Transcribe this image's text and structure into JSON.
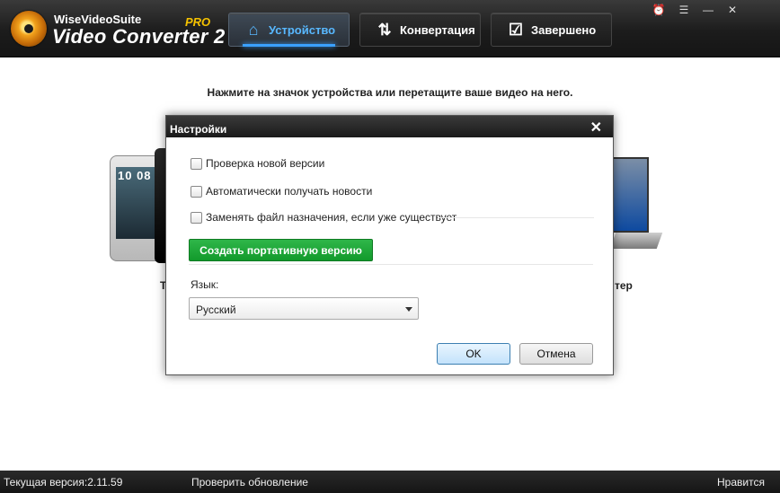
{
  "app": {
    "brand_small": "WiseVideoSuite",
    "brand_edition": "PRO",
    "brand_big": "Video Converter 2"
  },
  "tabs": [
    {
      "label": "Устройство",
      "icon": "home-icon",
      "active": true
    },
    {
      "label": "Конвертация",
      "icon": "convert-arrows-icon",
      "active": false
    },
    {
      "label": "Завершено",
      "icon": "checkbox-check-icon",
      "active": false
    }
  ],
  "window_controls": [
    "alarm-icon",
    "menu-icon",
    "minimize-icon",
    "close-icon"
  ],
  "main": {
    "instruction": "Нажмите на значок устройства или перетащите ваше видео на него.",
    "phone_clock": "10 08",
    "label_left_partial": "Т",
    "label_right_partial": "тер"
  },
  "dialog": {
    "title": "Настройки",
    "options": [
      {
        "label": "Проверка новой версии",
        "checked": false
      },
      {
        "label": "Автоматически получать новости",
        "checked": false
      },
      {
        "label": "Заменять файл назначения, если уже существует",
        "checked": false
      }
    ],
    "portable_button": "Создать портативную версию",
    "language_label": "Язык:",
    "language_value": "Русский",
    "ok_button": "OK",
    "cancel_button": "Отмена"
  },
  "status": {
    "version_text": "Текущая версия:2.11.59",
    "check_update": "Проверить обновление",
    "like": "Нравится"
  },
  "colors": {
    "accent_blue": "#3aa0ff",
    "portable_green": "#129a2b",
    "header_dark": "#1c1c1c"
  }
}
